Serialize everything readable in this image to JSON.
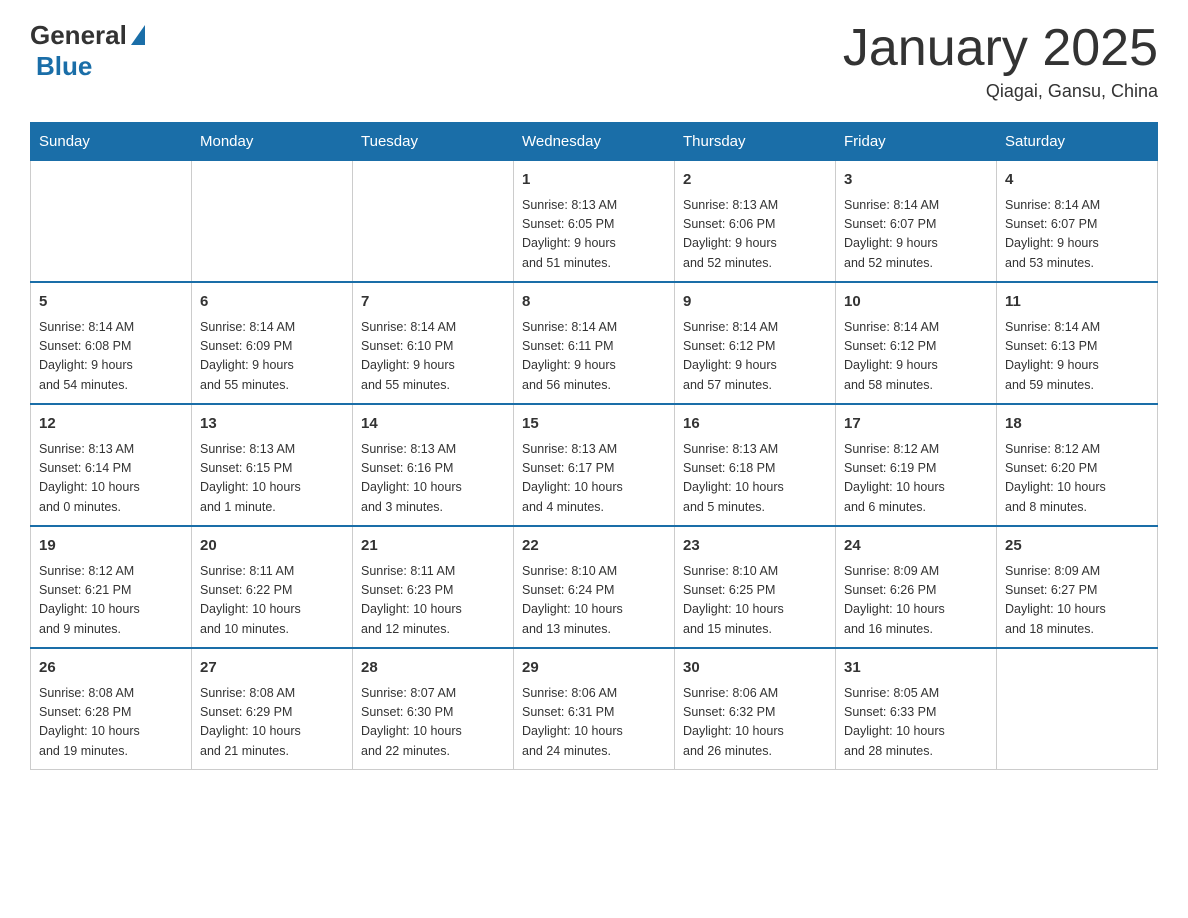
{
  "header": {
    "logo_text": "General",
    "logo_blue": "Blue",
    "month_title": "January 2025",
    "location": "Qiagai, Gansu, China"
  },
  "days_of_week": [
    "Sunday",
    "Monday",
    "Tuesday",
    "Wednesday",
    "Thursday",
    "Friday",
    "Saturday"
  ],
  "weeks": [
    [
      {
        "day": "",
        "info": ""
      },
      {
        "day": "",
        "info": ""
      },
      {
        "day": "",
        "info": ""
      },
      {
        "day": "1",
        "info": "Sunrise: 8:13 AM\nSunset: 6:05 PM\nDaylight: 9 hours\nand 51 minutes."
      },
      {
        "day": "2",
        "info": "Sunrise: 8:13 AM\nSunset: 6:06 PM\nDaylight: 9 hours\nand 52 minutes."
      },
      {
        "day": "3",
        "info": "Sunrise: 8:14 AM\nSunset: 6:07 PM\nDaylight: 9 hours\nand 52 minutes."
      },
      {
        "day": "4",
        "info": "Sunrise: 8:14 AM\nSunset: 6:07 PM\nDaylight: 9 hours\nand 53 minutes."
      }
    ],
    [
      {
        "day": "5",
        "info": "Sunrise: 8:14 AM\nSunset: 6:08 PM\nDaylight: 9 hours\nand 54 minutes."
      },
      {
        "day": "6",
        "info": "Sunrise: 8:14 AM\nSunset: 6:09 PM\nDaylight: 9 hours\nand 55 minutes."
      },
      {
        "day": "7",
        "info": "Sunrise: 8:14 AM\nSunset: 6:10 PM\nDaylight: 9 hours\nand 55 minutes."
      },
      {
        "day": "8",
        "info": "Sunrise: 8:14 AM\nSunset: 6:11 PM\nDaylight: 9 hours\nand 56 minutes."
      },
      {
        "day": "9",
        "info": "Sunrise: 8:14 AM\nSunset: 6:12 PM\nDaylight: 9 hours\nand 57 minutes."
      },
      {
        "day": "10",
        "info": "Sunrise: 8:14 AM\nSunset: 6:12 PM\nDaylight: 9 hours\nand 58 minutes."
      },
      {
        "day": "11",
        "info": "Sunrise: 8:14 AM\nSunset: 6:13 PM\nDaylight: 9 hours\nand 59 minutes."
      }
    ],
    [
      {
        "day": "12",
        "info": "Sunrise: 8:13 AM\nSunset: 6:14 PM\nDaylight: 10 hours\nand 0 minutes."
      },
      {
        "day": "13",
        "info": "Sunrise: 8:13 AM\nSunset: 6:15 PM\nDaylight: 10 hours\nand 1 minute."
      },
      {
        "day": "14",
        "info": "Sunrise: 8:13 AM\nSunset: 6:16 PM\nDaylight: 10 hours\nand 3 minutes."
      },
      {
        "day": "15",
        "info": "Sunrise: 8:13 AM\nSunset: 6:17 PM\nDaylight: 10 hours\nand 4 minutes."
      },
      {
        "day": "16",
        "info": "Sunrise: 8:13 AM\nSunset: 6:18 PM\nDaylight: 10 hours\nand 5 minutes."
      },
      {
        "day": "17",
        "info": "Sunrise: 8:12 AM\nSunset: 6:19 PM\nDaylight: 10 hours\nand 6 minutes."
      },
      {
        "day": "18",
        "info": "Sunrise: 8:12 AM\nSunset: 6:20 PM\nDaylight: 10 hours\nand 8 minutes."
      }
    ],
    [
      {
        "day": "19",
        "info": "Sunrise: 8:12 AM\nSunset: 6:21 PM\nDaylight: 10 hours\nand 9 minutes."
      },
      {
        "day": "20",
        "info": "Sunrise: 8:11 AM\nSunset: 6:22 PM\nDaylight: 10 hours\nand 10 minutes."
      },
      {
        "day": "21",
        "info": "Sunrise: 8:11 AM\nSunset: 6:23 PM\nDaylight: 10 hours\nand 12 minutes."
      },
      {
        "day": "22",
        "info": "Sunrise: 8:10 AM\nSunset: 6:24 PM\nDaylight: 10 hours\nand 13 minutes."
      },
      {
        "day": "23",
        "info": "Sunrise: 8:10 AM\nSunset: 6:25 PM\nDaylight: 10 hours\nand 15 minutes."
      },
      {
        "day": "24",
        "info": "Sunrise: 8:09 AM\nSunset: 6:26 PM\nDaylight: 10 hours\nand 16 minutes."
      },
      {
        "day": "25",
        "info": "Sunrise: 8:09 AM\nSunset: 6:27 PM\nDaylight: 10 hours\nand 18 minutes."
      }
    ],
    [
      {
        "day": "26",
        "info": "Sunrise: 8:08 AM\nSunset: 6:28 PM\nDaylight: 10 hours\nand 19 minutes."
      },
      {
        "day": "27",
        "info": "Sunrise: 8:08 AM\nSunset: 6:29 PM\nDaylight: 10 hours\nand 21 minutes."
      },
      {
        "day": "28",
        "info": "Sunrise: 8:07 AM\nSunset: 6:30 PM\nDaylight: 10 hours\nand 22 minutes."
      },
      {
        "day": "29",
        "info": "Sunrise: 8:06 AM\nSunset: 6:31 PM\nDaylight: 10 hours\nand 24 minutes."
      },
      {
        "day": "30",
        "info": "Sunrise: 8:06 AM\nSunset: 6:32 PM\nDaylight: 10 hours\nand 26 minutes."
      },
      {
        "day": "31",
        "info": "Sunrise: 8:05 AM\nSunset: 6:33 PM\nDaylight: 10 hours\nand 28 minutes."
      },
      {
        "day": "",
        "info": ""
      }
    ]
  ]
}
